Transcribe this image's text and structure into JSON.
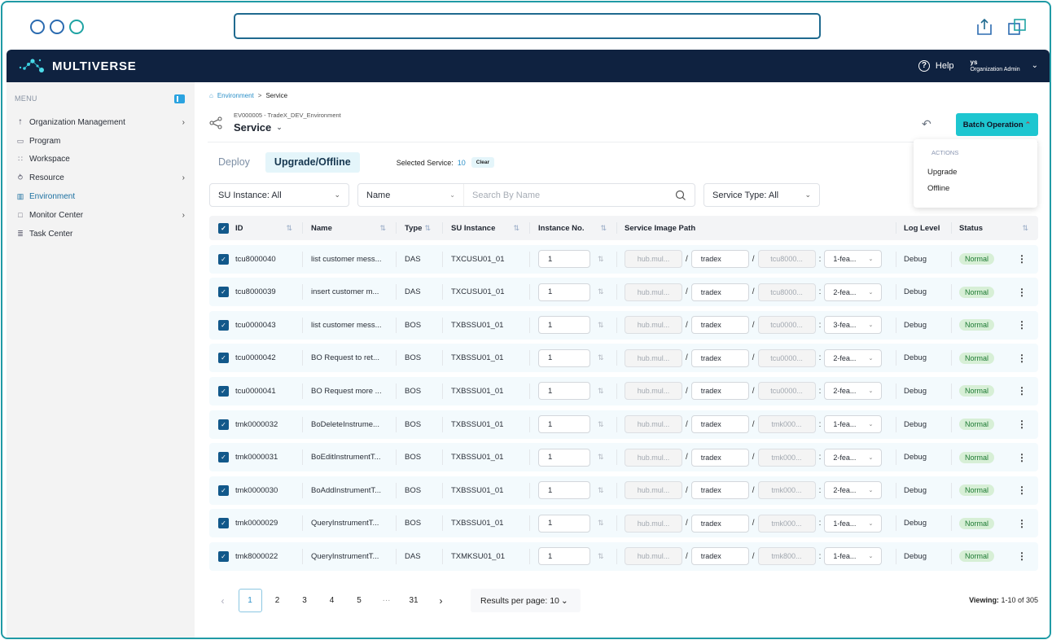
{
  "browser": {
    "url": "",
    "icons": [
      "share-icon",
      "duplicate-window-icon"
    ]
  },
  "header": {
    "logo_text": "MULTIVERSE",
    "help_label": "Help",
    "user_name": "ys",
    "user_role": "Organization Admin"
  },
  "sidebar": {
    "menu_label": "MENU",
    "items": [
      {
        "label": "Organization Management",
        "icon": "org-icon",
        "has_arrow": true,
        "active": false
      },
      {
        "label": "Program",
        "icon": "program-icon",
        "has_arrow": false,
        "active": false
      },
      {
        "label": "Workspace",
        "icon": "workspace-icon",
        "has_arrow": false,
        "active": false
      },
      {
        "label": "Resource",
        "icon": "resource-icon",
        "has_arrow": true,
        "active": false
      },
      {
        "label": "Environment",
        "icon": "environment-icon",
        "has_arrow": false,
        "active": true
      },
      {
        "label": "Monitor Center",
        "icon": "monitor-icon",
        "has_arrow": true,
        "active": false
      },
      {
        "label": "Task Center",
        "icon": "task-icon",
        "has_arrow": false,
        "active": false
      }
    ]
  },
  "breadcrumb": {
    "parent": "Environment",
    "separator": ">",
    "current": "Service"
  },
  "page": {
    "env_subtitle": "EV000005 - TradeX_DEV_Environment",
    "title": "Service",
    "batch_button": "Batch Operation",
    "batch_menu": {
      "header": "ACTIONS",
      "items": [
        "Upgrade",
        "Offline"
      ]
    }
  },
  "tabs": {
    "items": [
      {
        "label": "Deploy",
        "active": false
      },
      {
        "label": "Upgrade/Offline",
        "active": true
      }
    ],
    "selected_label": "Selected Service:",
    "selected_count": "10",
    "clear_label": "Clear"
  },
  "filters": {
    "su_instance": "SU Instance: All",
    "name_field": "Name",
    "search_placeholder": "Search By Name",
    "service_type": "Service Type: All"
  },
  "table": {
    "columns": [
      "ID",
      "Name",
      "Type",
      "SU Instance",
      "Instance No.",
      "Service Image Path",
      "Log Level",
      "Status"
    ],
    "rows": [
      {
        "id": "tcu8000040",
        "name": "list customer mess...",
        "type": "DAS",
        "su": "TXCUSU01_01",
        "instance": "1",
        "registry": "hub.mul...",
        "repo": "tradex",
        "image": "tcu8000...",
        "tag": "1-fea...",
        "log": "Debug",
        "status": "Normal",
        "checked": true
      },
      {
        "id": "tcu8000039",
        "name": "insert customer m...",
        "type": "DAS",
        "su": "TXCUSU01_01",
        "instance": "1",
        "registry": "hub.mul...",
        "repo": "tradex",
        "image": "tcu8000...",
        "tag": "2-fea...",
        "log": "Debug",
        "status": "Normal",
        "checked": true
      },
      {
        "id": "tcu0000043",
        "name": "list customer mess...",
        "type": "BOS",
        "su": "TXBSSU01_01",
        "instance": "1",
        "registry": "hub.mul...",
        "repo": "tradex",
        "image": "tcu0000...",
        "tag": "3-fea...",
        "log": "Debug",
        "status": "Normal",
        "checked": true
      },
      {
        "id": "tcu0000042",
        "name": "BO Request to ret...",
        "type": "BOS",
        "su": "TXBSSU01_01",
        "instance": "1",
        "registry": "hub.mul...",
        "repo": "tradex",
        "image": "tcu0000...",
        "tag": "2-fea...",
        "log": "Debug",
        "status": "Normal",
        "checked": true
      },
      {
        "id": "tcu0000041",
        "name": "BO Request more ...",
        "type": "BOS",
        "su": "TXBSSU01_01",
        "instance": "1",
        "registry": "hub.mul...",
        "repo": "tradex",
        "image": "tcu0000...",
        "tag": "2-fea...",
        "log": "Debug",
        "status": "Normal",
        "checked": true
      },
      {
        "id": "tmk0000032",
        "name": "BoDeleteInstrume...",
        "type": "BOS",
        "su": "TXBSSU01_01",
        "instance": "1",
        "registry": "hub.mul...",
        "repo": "tradex",
        "image": "tmk000...",
        "tag": "1-fea...",
        "log": "Debug",
        "status": "Normal",
        "checked": true
      },
      {
        "id": "tmk0000031",
        "name": "BoEditInstrumentT...",
        "type": "BOS",
        "su": "TXBSSU01_01",
        "instance": "1",
        "registry": "hub.mul...",
        "repo": "tradex",
        "image": "tmk000...",
        "tag": "2-fea...",
        "log": "Debug",
        "status": "Normal",
        "checked": true
      },
      {
        "id": "tmk0000030",
        "name": "BoAddInstrumentT...",
        "type": "BOS",
        "su": "TXBSSU01_01",
        "instance": "1",
        "registry": "hub.mul...",
        "repo": "tradex",
        "image": "tmk000...",
        "tag": "2-fea...",
        "log": "Debug",
        "status": "Normal",
        "checked": true
      },
      {
        "id": "tmk0000029",
        "name": "QueryInstrumentT...",
        "type": "BOS",
        "su": "TXBSSU01_01",
        "instance": "1",
        "registry": "hub.mul...",
        "repo": "tradex",
        "image": "tmk000...",
        "tag": "1-fea...",
        "log": "Debug",
        "status": "Normal",
        "checked": true
      },
      {
        "id": "tmk8000022",
        "name": "QueryInstrumentT...",
        "type": "DAS",
        "su": "TXMKSU01_01",
        "instance": "1",
        "registry": "hub.mul...",
        "repo": "tradex",
        "image": "tmk800...",
        "tag": "1-fea...",
        "log": "Debug",
        "status": "Normal",
        "checked": true
      }
    ]
  },
  "pagination": {
    "pages": [
      "1",
      "2",
      "3",
      "4",
      "5",
      "···",
      "31"
    ],
    "current": "1",
    "per_page_label": "Results per page: 10",
    "viewing_label": "Viewing:",
    "viewing_range": "1-10 of 305"
  },
  "colors": {
    "header_bg": "#0f2240",
    "accent": "#1ec6d0",
    "link": "#2a8fc8",
    "checkbox": "#12588a",
    "status_bg": "#d7efd6",
    "status_text": "#1c7a32"
  }
}
